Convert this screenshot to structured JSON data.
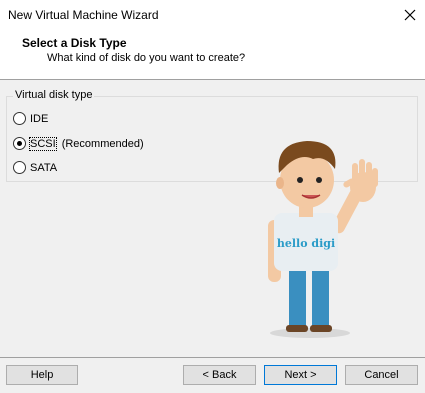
{
  "window": {
    "title": "New Virtual Machine Wizard"
  },
  "header": {
    "title": "Select a Disk Type",
    "subtitle": "What kind of disk do you want to create?"
  },
  "disk_type": {
    "legend": "Virtual disk type",
    "options": [
      {
        "label": "IDE",
        "note": "",
        "selected": false
      },
      {
        "label": "SCSI",
        "note": "(Recommended)",
        "selected": true
      },
      {
        "label": "SATA",
        "note": "",
        "selected": false
      }
    ]
  },
  "mascot": {
    "shirt_text": "hello digi"
  },
  "buttons": {
    "help": "Help",
    "back": "< Back",
    "next": "Next >",
    "cancel": "Cancel"
  },
  "colors": {
    "shirt": "#e8eef2",
    "pants": "#3a8fc0",
    "hair": "#7a4a1e",
    "skin": "#f3c9a3",
    "accent": "#0078d7"
  }
}
